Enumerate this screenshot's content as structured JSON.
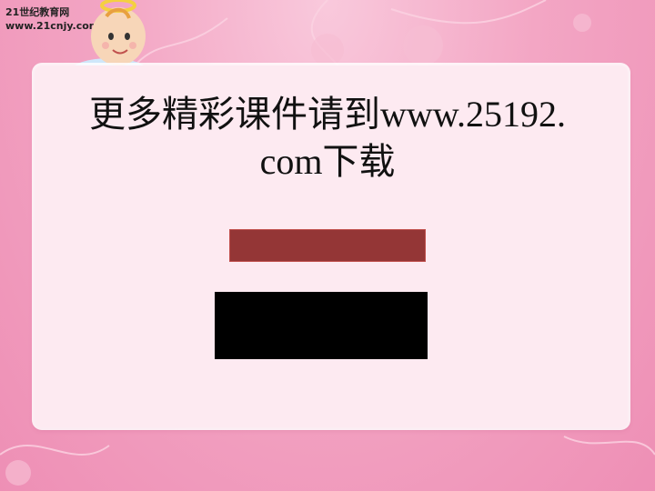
{
  "brand": {
    "line1": "21世纪教育网",
    "line2": "www.21cnjy.com"
  },
  "slide": {
    "title_line1": "更多精彩课件请到www.25192.",
    "title_line2": "com下载"
  },
  "colors": {
    "background": "#f3a6c4",
    "panel": "#fdeaf1",
    "red_bar": "#943636",
    "black_bar": "#000000"
  },
  "icons": {
    "mascot": "baby-angel-icon"
  }
}
